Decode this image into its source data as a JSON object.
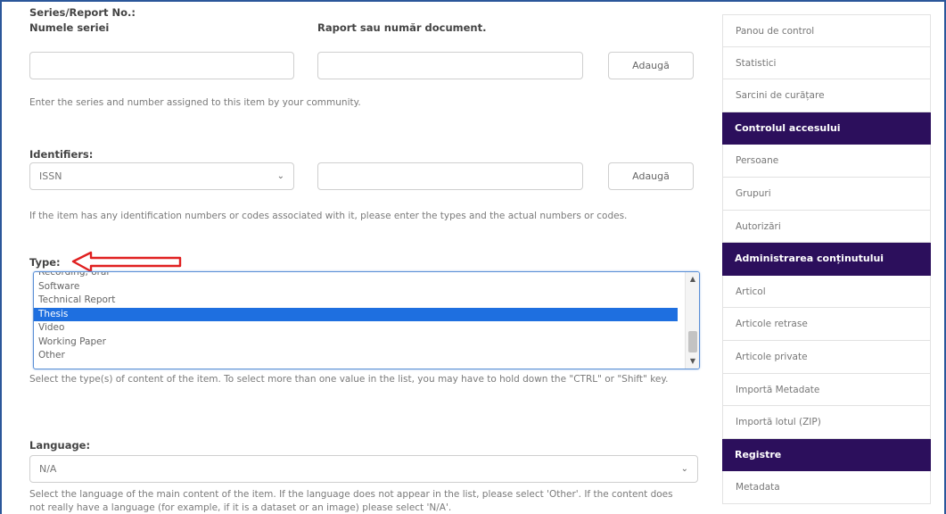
{
  "series": {
    "title": "Series/Report No.:",
    "name_label": "Numele seriei",
    "number_label": "Raport sau număr document.",
    "add_label": "Adaugă",
    "help": "Enter the series and number assigned to this item by your community."
  },
  "identifiers": {
    "title": "Identifiers:",
    "selected": "ISSN",
    "add_label": "Adaugă",
    "help": "If the item has any identification numbers or codes associated with it, please enter the types and the actual numbers or codes."
  },
  "type": {
    "title": "Type:",
    "options": [
      "Recording, oral",
      "Software",
      "Technical Report",
      "Thesis",
      "Video",
      "Working Paper",
      "Other"
    ],
    "selected": "Thesis",
    "help": "Select the type(s) of content of the item. To select more than one value in the list, you may have to hold down the \"CTRL\" or \"Shift\" key."
  },
  "language": {
    "title": "Language:",
    "selected": "N/A",
    "help": "Select the language of the main content of the item. If the language does not appear in the list, please select 'Other'. If the content does not really have a language (for example, if it is a dataset or an image) please select 'N/A'."
  },
  "sidebar": {
    "items": [
      {
        "kind": "item",
        "label": "Panou de control"
      },
      {
        "kind": "item",
        "label": "Statistici"
      },
      {
        "kind": "item",
        "label": "Sarcini de curățare"
      },
      {
        "kind": "head",
        "label": "Controlul accesului"
      },
      {
        "kind": "item",
        "label": "Persoane"
      },
      {
        "kind": "item",
        "label": "Grupuri"
      },
      {
        "kind": "item",
        "label": "Autorizări"
      },
      {
        "kind": "head",
        "label": "Administrarea conținutului"
      },
      {
        "kind": "item",
        "label": "Articol"
      },
      {
        "kind": "item",
        "label": "Articole retrase"
      },
      {
        "kind": "item",
        "label": "Articole private"
      },
      {
        "kind": "item",
        "label": "Importă Metadate"
      },
      {
        "kind": "item",
        "label": "Importă lotul (ZIP)"
      },
      {
        "kind": "head",
        "label": "Registre"
      },
      {
        "kind": "item",
        "label": "Metadata"
      }
    ]
  },
  "colors": {
    "sidebar_header": "#2c0f5c",
    "selection": "#1e6fe0",
    "annotation_arrow": "#e02020"
  }
}
